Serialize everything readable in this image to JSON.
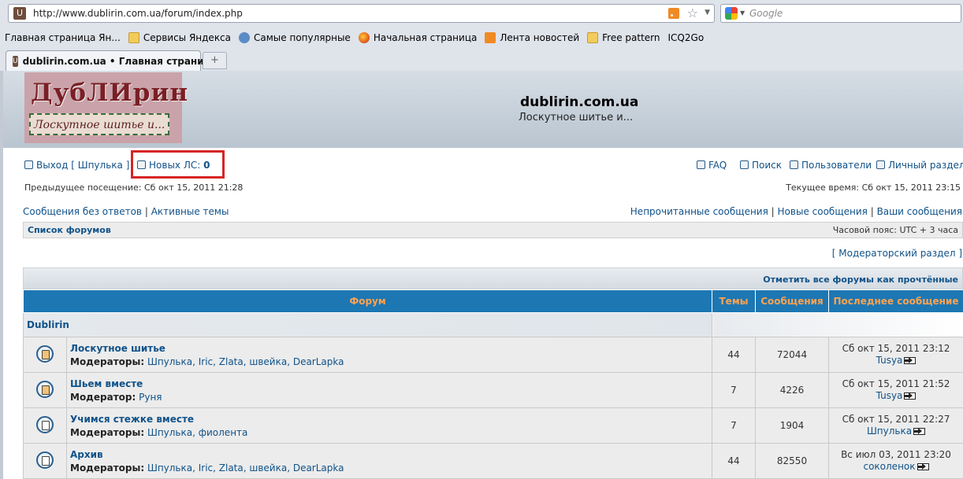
{
  "browser": {
    "url": "http://www.dublirin.com.ua/forum/index.php",
    "search_placeholder": "Google",
    "bookmarks": [
      {
        "label": "Главная страница Ян...",
        "icon": "none"
      },
      {
        "label": "Сервисы Яндекса",
        "icon": "folder-icon"
      },
      {
        "label": "Самые популярные",
        "icon": "popular-icon"
      },
      {
        "label": "Начальная страница",
        "icon": "firefox-icon"
      },
      {
        "label": "Лента новостей",
        "icon": "rss-feed-icon"
      },
      {
        "label": "Free pattern",
        "icon": "folder-icon"
      },
      {
        "label": "ICQ2Go",
        "icon": "page-icon"
      }
    ],
    "tab_title": "dublirin.com.ua • Главная страница",
    "new_tab_symbol": "+"
  },
  "header": {
    "logo_title": "ДубЛИрин",
    "logo_subtitle": "Лоскутное шитье и...",
    "site_name": "dublirin.com.ua",
    "site_description": "Лоскутное шитье и..."
  },
  "userbar": {
    "logout_label": "Выход [ Шпулька ]",
    "new_pm_label": "Новых ЛС:",
    "new_pm_count": "0",
    "faq_label": "FAQ",
    "search_label": "Поиск",
    "members_label": "Пользователи",
    "ucp_label": "Личный раздел",
    "last_visit": "Предыдущее посещение: Сб окт 15, 2011 21:28",
    "current_time": "Текущее время: Сб окт 15, 2011 23:15"
  },
  "quicklinks": {
    "unanswered": "Сообщения без ответов",
    "active": "Активные темы",
    "unread": "Непрочитанные сообщения",
    "new_posts": "Новые сообщения",
    "your_posts": "Ваши сообщения",
    "separator": "|"
  },
  "navbar": {
    "breadcrumb": "Список форумов",
    "timezone": "Часовой пояс: UTC + 3 часа"
  },
  "moderator_panel": "[ Модераторский раздел ]",
  "mark_all_read": "Отметить все форумы как прочтённые",
  "table": {
    "headers": [
      "Форум",
      "Темы",
      "Сообщения",
      "Последнее сообщение"
    ],
    "category": "Dublirin",
    "forums": [
      {
        "name": "Лоскутное шитье",
        "mods_label": "Модераторы:",
        "mods": "Шпулька, Iric, Zlata, швейка, DearLapka",
        "topics": "44",
        "posts": "72044",
        "last_date": "Сб окт 15, 2011 23:12",
        "last_user": "Tusya",
        "unread": true
      },
      {
        "name": "Шьем вместе",
        "mods_label": "Модератор:",
        "mods": "Руня",
        "topics": "7",
        "posts": "4226",
        "last_date": "Сб окт 15, 2011 21:52",
        "last_user": "Tusya",
        "unread": true
      },
      {
        "name": "Учимся стежке вместе",
        "mods_label": "Модераторы:",
        "mods": "Шпулька, фиолента",
        "topics": "7",
        "posts": "1904",
        "last_date": "Сб окт 15, 2011 22:27",
        "last_user": "Шпулька",
        "unread": false
      },
      {
        "name": "Архив",
        "mods_label": "Модераторы:",
        "mods": "Шпулька, Iric, Zlata, швейка, DearLapka",
        "topics": "44",
        "posts": "82550",
        "last_date": "Вс июл 03, 2011 23:20",
        "last_user": "соколенок",
        "unread": false
      }
    ]
  }
}
